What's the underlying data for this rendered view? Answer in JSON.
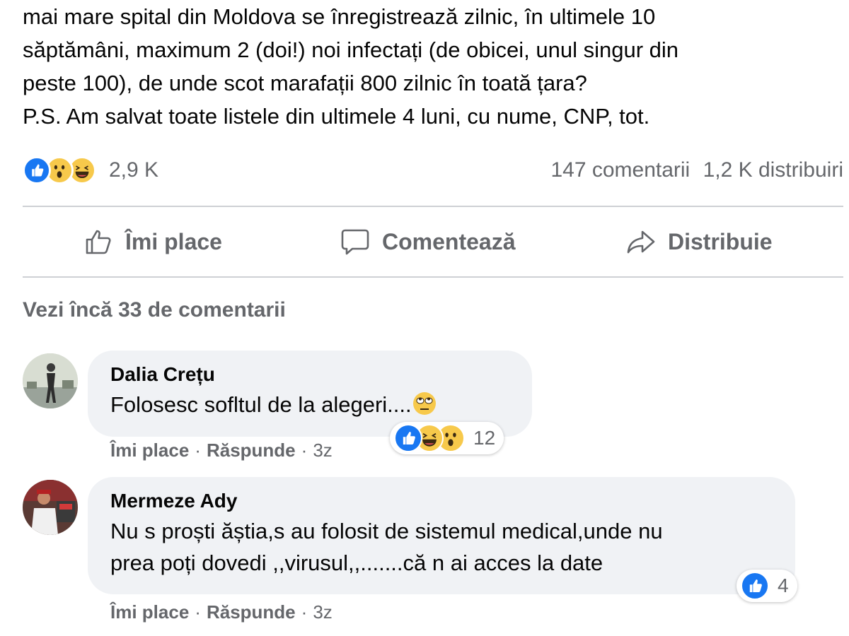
{
  "post": {
    "lines": [
      "mai mare spital din Moldova se înregistrează zilnic, în ultimele 10",
      "săptămâni, maximum 2 (doi!) noi infectați (de obicei, unul singur din",
      "peste 100), de unde scot marafații 800 zilnic în toată țara?",
      "P.S. Am salvat toate listele din ultimele 4 luni, cu nume, CNP, tot."
    ],
    "reactions_count": "2,9 K",
    "comments_count": "147 comentarii",
    "shares_count": "1,2 K distribuiri",
    "reaction_icons": [
      "like-icon",
      "wow-icon",
      "haha-icon"
    ]
  },
  "actions": {
    "like": "Îmi place",
    "comment": "Comentează",
    "share": "Distribuie"
  },
  "more_comments": "Vezi încă 33 de comentarii",
  "comments": [
    {
      "author": "Dalia Crețu",
      "text": "Folosesc sofltul de la alegeri....",
      "reactions_count": "12",
      "like_label": "Îmi place",
      "reply_label": "Răspunde",
      "time": "3z"
    },
    {
      "author": "Mermeze Ady",
      "text_lines": [
        "Nu s proști ăștia,s au folosit de sistemul medical,unde nu",
        "prea poți dovedi ,,virusul,,.......că n ai acces la date"
      ],
      "reactions_count": "4",
      "like_label": "Îmi place",
      "reply_label": "Răspunde",
      "time": "3z"
    }
  ],
  "colors": {
    "like_blue": "#1877f2",
    "emoji_yellow": "#f7c94b",
    "secondary_text": "#65676b",
    "bubble_bg": "#f0f2f5",
    "divider": "#ced0d4"
  }
}
